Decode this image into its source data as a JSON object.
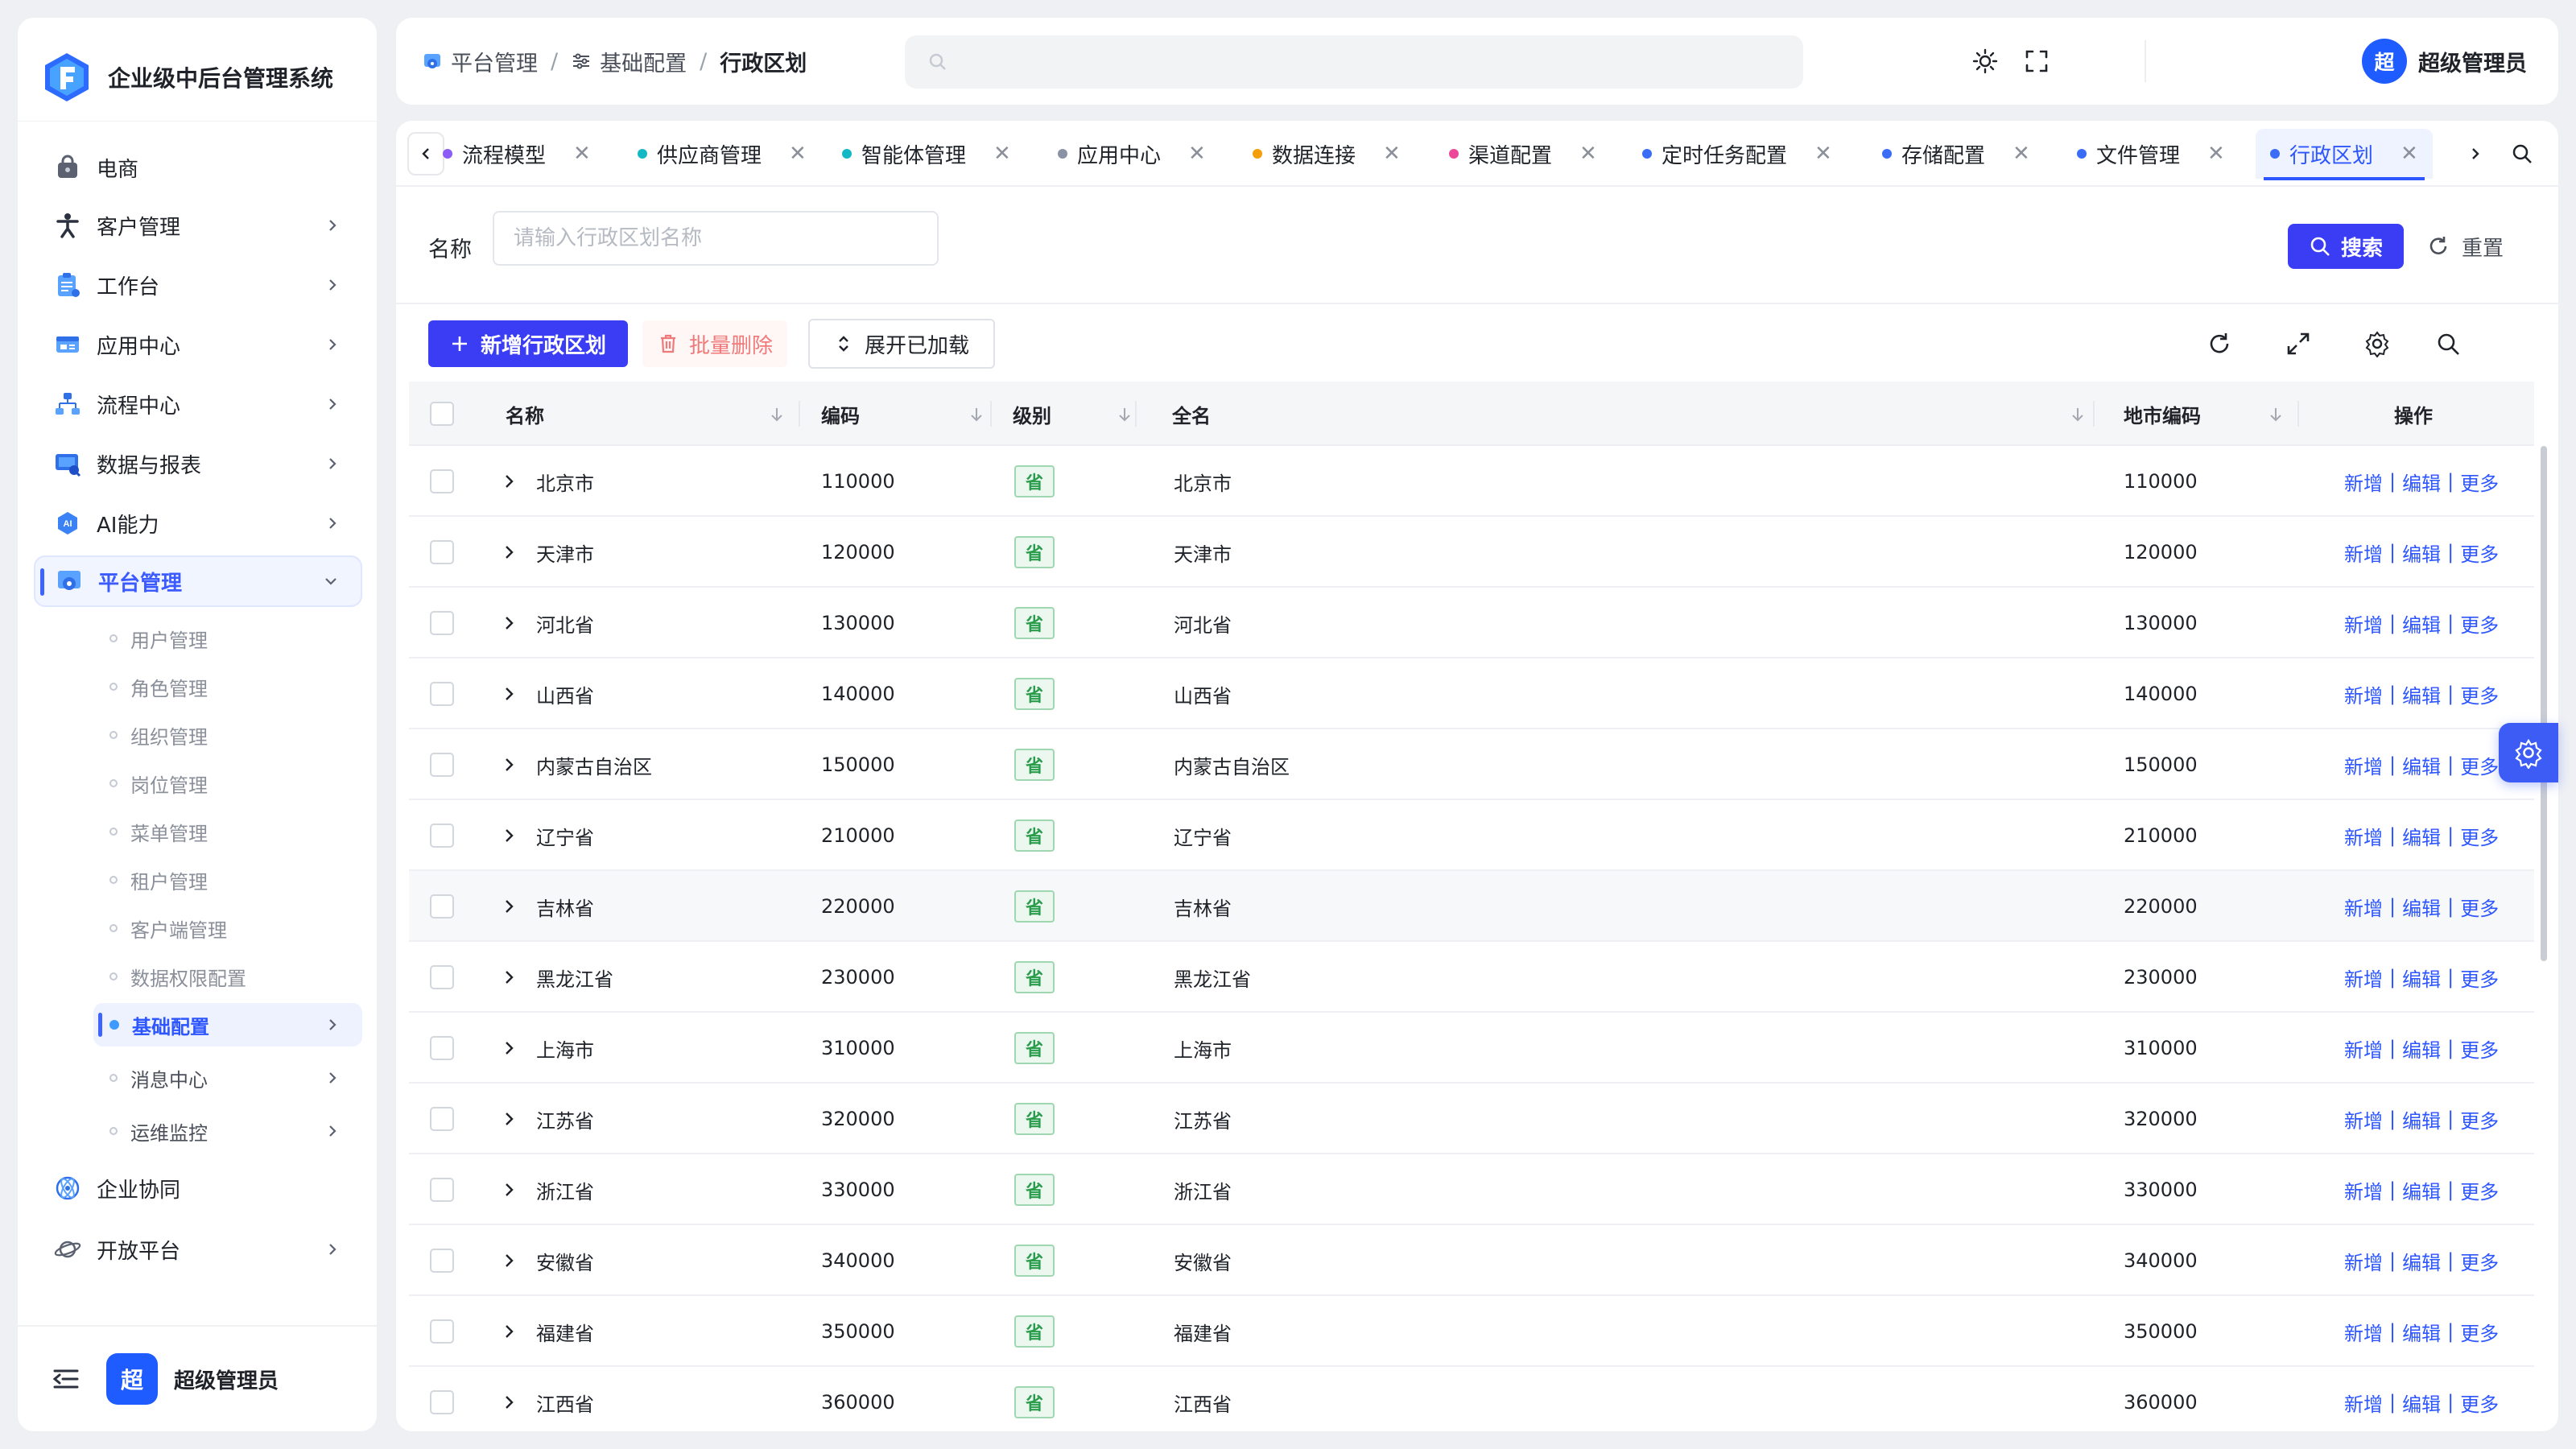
{
  "brand": {
    "title": "企业级中后台管理系统"
  },
  "sidebar": {
    "items": [
      {
        "label": "电商",
        "icon": "bag-icon",
        "has_children": false
      },
      {
        "label": "客户管理",
        "icon": "person-icon",
        "has_children": true
      },
      {
        "label": "工作台",
        "icon": "clipboard-icon",
        "has_children": true
      },
      {
        "label": "应用中心",
        "icon": "app-window-icon",
        "has_children": true
      },
      {
        "label": "流程中心",
        "icon": "flow-icon",
        "has_children": true
      },
      {
        "label": "数据与报表",
        "icon": "report-icon",
        "has_children": true
      },
      {
        "label": "AI能力",
        "icon": "ai-icon",
        "has_children": true
      },
      {
        "label": "平台管理",
        "icon": "platform-icon",
        "has_children": true,
        "expanded": true,
        "active": true
      }
    ],
    "sub_items": [
      {
        "label": "用户管理"
      },
      {
        "label": "角色管理"
      },
      {
        "label": "组织管理"
      },
      {
        "label": "岗位管理"
      },
      {
        "label": "菜单管理"
      },
      {
        "label": "租户管理"
      },
      {
        "label": "客户端管理"
      },
      {
        "label": "数据权限配置"
      },
      {
        "label": "基础配置",
        "active": true,
        "has_children": true
      },
      {
        "label": "消息中心",
        "has_children": true
      },
      {
        "label": "运维监控",
        "has_children": true
      }
    ],
    "bottom_items": [
      {
        "label": "企业协同",
        "icon": "collab-icon",
        "has_children": false
      },
      {
        "label": "开放平台",
        "icon": "planet-icon",
        "has_children": true
      }
    ],
    "footer": {
      "avatar_text": "超",
      "username": "超级管理员"
    }
  },
  "header": {
    "breadcrumb": [
      {
        "label": "平台管理",
        "icon": "platform-icon"
      },
      {
        "label": "基础配置",
        "icon": "sliders-icon"
      },
      {
        "label": "行政区划",
        "current": true
      }
    ],
    "search_placeholder": "",
    "user": {
      "avatar_text": "超",
      "name": "超级管理员"
    }
  },
  "tabs": [
    {
      "label": "流程模型",
      "color": "#8b5cf6"
    },
    {
      "label": "供应商管理",
      "color": "#14b8c4"
    },
    {
      "label": "智能体管理",
      "color": "#14b8c4"
    },
    {
      "label": "应用中心",
      "color": "#8a93a6"
    },
    {
      "label": "数据连接",
      "color": "#f59e0b"
    },
    {
      "label": "渠道配置",
      "color": "#ec4899"
    },
    {
      "label": "定时任务配置",
      "color": "#3b6cf6"
    },
    {
      "label": "存储配置",
      "color": "#3b6cf6"
    },
    {
      "label": "文件管理",
      "color": "#3b6cf6"
    },
    {
      "label": "行政区划",
      "color": "#3b6cf6",
      "active": true
    }
  ],
  "filter": {
    "label": "名称",
    "placeholder": "请输入行政区划名称",
    "search_label": "搜索",
    "reset_label": "重置"
  },
  "toolbar": {
    "add_label": "新增行政区划",
    "batch_delete_label": "批量删除",
    "expand_label": "展开已加载"
  },
  "table": {
    "columns": [
      "名称",
      "编码",
      "级别",
      "全名",
      "地市编码",
      "操作"
    ],
    "actions": [
      "新增",
      "编辑",
      "更多"
    ],
    "rows": [
      {
        "name": "北京市",
        "code": "110000",
        "level": "省",
        "full_name": "北京市",
        "city_code": "110000"
      },
      {
        "name": "天津市",
        "code": "120000",
        "level": "省",
        "full_name": "天津市",
        "city_code": "120000"
      },
      {
        "name": "河北省",
        "code": "130000",
        "level": "省",
        "full_name": "河北省",
        "city_code": "130000"
      },
      {
        "name": "山西省",
        "code": "140000",
        "level": "省",
        "full_name": "山西省",
        "city_code": "140000"
      },
      {
        "name": "内蒙古自治区",
        "code": "150000",
        "level": "省",
        "full_name": "内蒙古自治区",
        "city_code": "150000"
      },
      {
        "name": "辽宁省",
        "code": "210000",
        "level": "省",
        "full_name": "辽宁省",
        "city_code": "210000"
      },
      {
        "name": "吉林省",
        "code": "220000",
        "level": "省",
        "full_name": "吉林省",
        "city_code": "220000"
      },
      {
        "name": "黑龙江省",
        "code": "230000",
        "level": "省",
        "full_name": "黑龙江省",
        "city_code": "230000"
      },
      {
        "name": "上海市",
        "code": "310000",
        "level": "省",
        "full_name": "上海市",
        "city_code": "310000"
      },
      {
        "name": "江苏省",
        "code": "320000",
        "level": "省",
        "full_name": "江苏省",
        "city_code": "320000"
      },
      {
        "name": "浙江省",
        "code": "330000",
        "level": "省",
        "full_name": "浙江省",
        "city_code": "330000"
      },
      {
        "name": "安徽省",
        "code": "340000",
        "level": "省",
        "full_name": "安徽省",
        "city_code": "340000"
      },
      {
        "name": "福建省",
        "code": "350000",
        "level": "省",
        "full_name": "福建省",
        "city_code": "350000"
      },
      {
        "name": "江西省",
        "code": "360000",
        "level": "省",
        "full_name": "江西省",
        "city_code": "360000"
      }
    ]
  },
  "colors": {
    "primary": "#3b3df5",
    "accent": "#2d56ff",
    "tag_green": "#2a9d4c"
  }
}
